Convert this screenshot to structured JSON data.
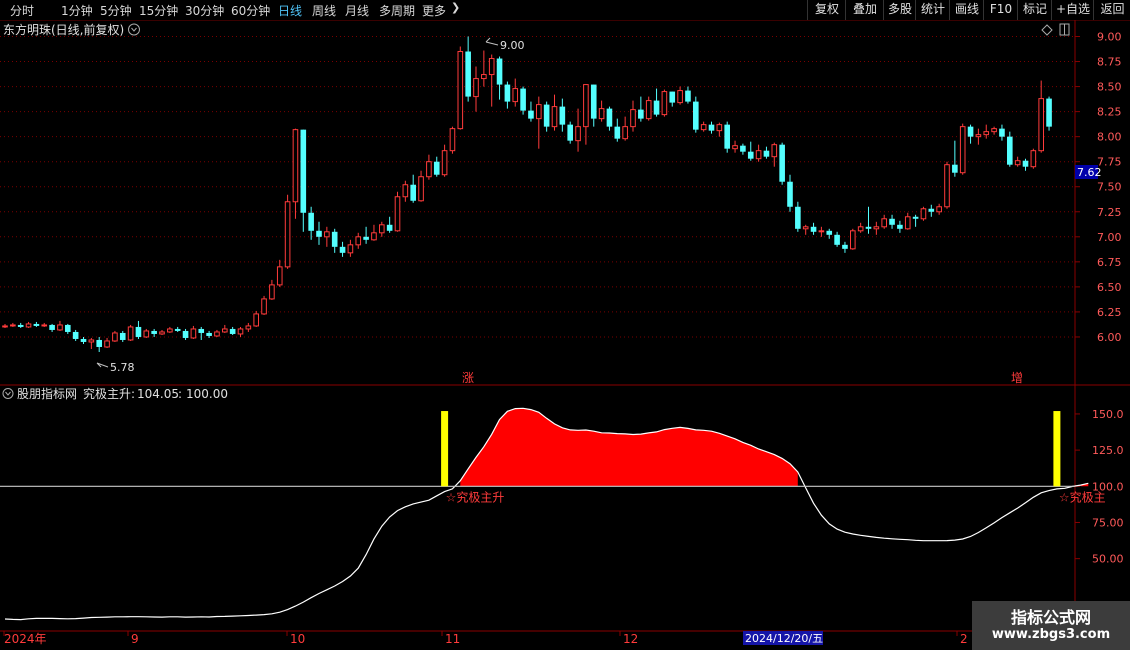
{
  "toolbar": {
    "periods": [
      "分时",
      "1分钟",
      "5分钟",
      "15分钟",
      "30分钟",
      "60分钟",
      "日线",
      "周线",
      "月线",
      "多周期",
      "更多"
    ],
    "active_period": "日线",
    "right_buttons": [
      "复权",
      "叠加",
      "多股",
      "统计",
      "画线",
      "F10",
      "标记",
      "+自选",
      "返回"
    ]
  },
  "main_chart": {
    "title": "东方明珠(日线,前复权)",
    "high_label": "9.00",
    "low_label": "5.78",
    "current_price": "7.62",
    "y_ticks": [
      "9.00",
      "8.75",
      "8.50",
      "8.25",
      "8.00",
      "7.75",
      "7.50",
      "7.25",
      "7.00",
      "6.75",
      "6.50",
      "6.25",
      "6.00"
    ],
    "markers": [
      "涨",
      "增"
    ],
    "colors": {
      "up": "#ff3b3b",
      "down": "#54ffff",
      "grid": "#7a0000"
    }
  },
  "indicator": {
    "source": "股朋指标网",
    "name": "究极主升",
    "value": "104.05",
    "ref": "100.00",
    "signal_label": "☆究极主升",
    "signal_label_cut": "☆究极主",
    "y_ticks": [
      "150.0",
      "125.0",
      "100.0",
      "75.00",
      "50.00"
    ],
    "colors": {
      "fill": "#ff0000",
      "line": "#ffffff",
      "bar": "#ffff00"
    }
  },
  "date_axis": {
    "labels": [
      "2024年",
      "9",
      "10",
      "11",
      "12",
      "2"
    ],
    "cursor_date": "2024/12/20/五"
  },
  "watermark": {
    "title": "指标公式网",
    "url": "www.zbgs3.com"
  },
  "chart_data": {
    "type": "candlestick",
    "candles": [
      [
        6.1,
        6.11,
        6.13,
        6.09
      ],
      [
        6.11,
        6.12,
        6.14,
        6.1
      ],
      [
        6.12,
        6.1,
        6.14,
        6.09
      ],
      [
        6.1,
        6.13,
        6.15,
        6.09
      ],
      [
        6.13,
        6.11,
        6.15,
        6.1
      ],
      [
        6.11,
        6.12,
        6.14,
        6.1
      ],
      [
        6.12,
        6.07,
        6.13,
        6.05
      ],
      [
        6.07,
        6.12,
        6.16,
        6.06
      ],
      [
        6.12,
        6.05,
        6.13,
        6.03
      ],
      [
        6.05,
        5.98,
        6.07,
        5.96
      ],
      [
        5.98,
        5.95,
        6.0,
        5.93
      ],
      [
        5.95,
        5.97,
        5.99,
        5.88
      ],
      [
        5.97,
        5.9,
        6.0,
        5.85
      ],
      [
        5.9,
        5.96,
        5.99,
        5.89
      ],
      [
        5.96,
        6.04,
        6.06,
        5.95
      ],
      [
        6.04,
        5.97,
        6.06,
        5.95
      ],
      [
        5.97,
        6.1,
        6.12,
        5.96
      ],
      [
        6.1,
        6.0,
        6.16,
        5.98
      ],
      [
        6.0,
        6.06,
        6.08,
        5.99
      ],
      [
        6.06,
        6.03,
        6.08,
        6.0
      ],
      [
        6.03,
        6.05,
        6.07,
        6.02
      ],
      [
        6.05,
        6.08,
        6.1,
        6.04
      ],
      [
        6.08,
        6.06,
        6.1,
        6.05
      ],
      [
        6.06,
        5.99,
        6.08,
        5.97
      ],
      [
        5.99,
        6.08,
        6.11,
        5.98
      ],
      [
        6.08,
        6.04,
        6.1,
        5.97
      ],
      [
        6.04,
        6.01,
        6.06,
        5.99
      ],
      [
        6.01,
        6.05,
        6.07,
        6.0
      ],
      [
        6.05,
        6.08,
        6.12,
        6.04
      ],
      [
        6.08,
        6.03,
        6.1,
        6.02
      ],
      [
        6.03,
        6.08,
        6.1,
        6.0
      ],
      [
        6.08,
        6.11,
        6.14,
        6.05
      ],
      [
        6.11,
        6.23,
        6.26,
        6.1
      ],
      [
        6.23,
        6.38,
        6.41,
        6.22
      ],
      [
        6.38,
        6.52,
        6.57,
        6.37
      ],
      [
        6.52,
        6.7,
        6.77,
        6.5
      ],
      [
        6.7,
        7.35,
        7.42,
        6.68
      ],
      [
        7.35,
        8.07,
        8.08,
        7.18
      ],
      [
        8.07,
        7.24,
        8.07,
        7.05
      ],
      [
        7.24,
        7.06,
        7.3,
        6.97
      ],
      [
        7.06,
        7.0,
        7.15,
        6.92
      ],
      [
        7.0,
        7.05,
        7.1,
        6.9
      ],
      [
        7.05,
        6.9,
        7.08,
        6.84
      ],
      [
        6.9,
        6.84,
        6.95,
        6.8
      ],
      [
        6.84,
        6.92,
        6.97,
        6.8
      ],
      [
        6.92,
        7.0,
        7.04,
        6.88
      ],
      [
        7.0,
        6.97,
        7.1,
        6.93
      ],
      [
        6.97,
        7.04,
        7.12,
        6.96
      ],
      [
        7.04,
        7.12,
        7.15,
        7.0
      ],
      [
        7.12,
        7.06,
        7.2,
        7.04
      ],
      [
        7.06,
        7.4,
        7.45,
        7.05
      ],
      [
        7.4,
        7.52,
        7.56,
        7.35
      ],
      [
        7.52,
        7.36,
        7.62,
        7.34
      ],
      [
        7.36,
        7.6,
        7.66,
        7.35
      ],
      [
        7.6,
        7.75,
        7.82,
        7.57
      ],
      [
        7.75,
        7.62,
        7.8,
        7.6
      ],
      [
        7.62,
        7.86,
        7.92,
        7.6
      ],
      [
        7.86,
        8.08,
        8.1,
        7.83
      ],
      [
        8.08,
        8.85,
        8.9,
        8.07
      ],
      [
        8.85,
        8.4,
        9.0,
        8.35
      ],
      [
        8.4,
        8.58,
        8.7,
        8.25
      ],
      [
        8.58,
        8.62,
        8.86,
        8.5
      ],
      [
        8.62,
        8.78,
        8.82,
        8.3
      ],
      [
        8.78,
        8.52,
        8.8,
        8.37
      ],
      [
        8.52,
        8.35,
        8.55,
        8.28
      ],
      [
        8.35,
        8.48,
        8.58,
        8.3
      ],
      [
        8.48,
        8.26,
        8.5,
        8.22
      ],
      [
        8.26,
        8.18,
        8.35,
        8.15
      ],
      [
        8.18,
        8.32,
        8.4,
        7.88
      ],
      [
        8.32,
        8.1,
        8.35,
        8.05
      ],
      [
        8.1,
        8.3,
        8.42,
        8.06
      ],
      [
        8.3,
        8.12,
        8.38,
        8.05
      ],
      [
        8.12,
        7.96,
        8.15,
        7.93
      ],
      [
        7.96,
        8.1,
        8.28,
        7.85
      ],
      [
        8.1,
        8.52,
        8.52,
        7.92
      ],
      [
        8.52,
        8.18,
        8.52,
        8.1
      ],
      [
        8.18,
        8.28,
        8.36,
        8.15
      ],
      [
        8.28,
        8.1,
        8.3,
        8.06
      ],
      [
        8.1,
        7.98,
        8.18,
        7.95
      ],
      [
        7.98,
        8.1,
        8.2,
        7.96
      ],
      [
        8.1,
        8.27,
        8.36,
        8.05
      ],
      [
        8.27,
        8.18,
        8.4,
        8.15
      ],
      [
        8.18,
        8.36,
        8.4,
        8.16
      ],
      [
        8.36,
        8.22,
        8.48,
        8.2
      ],
      [
        8.22,
        8.45,
        8.47,
        8.2
      ],
      [
        8.45,
        8.34,
        8.45,
        8.3
      ],
      [
        8.34,
        8.46,
        8.5,
        8.32
      ],
      [
        8.46,
        8.35,
        8.5,
        8.33
      ],
      [
        8.35,
        8.07,
        8.4,
        8.04
      ],
      [
        8.07,
        8.12,
        8.15,
        8.05
      ],
      [
        8.12,
        8.06,
        8.15,
        8.03
      ],
      [
        8.06,
        8.12,
        8.14,
        8.0
      ],
      [
        8.12,
        7.88,
        8.15,
        7.84
      ],
      [
        7.88,
        7.91,
        7.96,
        7.84
      ],
      [
        7.91,
        7.85,
        7.93,
        7.82
      ],
      [
        7.85,
        7.78,
        7.95,
        7.76
      ],
      [
        7.78,
        7.86,
        7.92,
        7.75
      ],
      [
        7.86,
        7.8,
        7.9,
        7.78
      ],
      [
        7.8,
        7.92,
        7.94,
        7.7
      ],
      [
        7.92,
        7.55,
        7.94,
        7.52
      ],
      [
        7.55,
        7.3,
        7.62,
        7.25
      ],
      [
        7.3,
        7.08,
        7.35,
        7.05
      ],
      [
        7.08,
        7.1,
        7.12,
        7.02
      ],
      [
        7.1,
        7.05,
        7.14,
        7.02
      ],
      [
        7.05,
        7.06,
        7.1,
        7.0
      ],
      [
        7.06,
        7.02,
        7.08,
        6.98
      ],
      [
        7.02,
        6.92,
        7.05,
        6.9
      ],
      [
        6.92,
        6.88,
        6.95,
        6.84
      ],
      [
        6.88,
        7.06,
        7.08,
        6.87
      ],
      [
        7.06,
        7.1,
        7.14,
        7.04
      ],
      [
        7.1,
        7.08,
        7.3,
        7.03
      ],
      [
        7.08,
        7.1,
        7.15,
        7.02
      ],
      [
        7.1,
        7.18,
        7.22,
        7.08
      ],
      [
        7.18,
        7.12,
        7.22,
        7.08
      ],
      [
        7.12,
        7.08,
        7.16,
        7.04
      ],
      [
        7.08,
        7.2,
        7.24,
        7.07
      ],
      [
        7.2,
        7.18,
        7.22,
        7.1
      ],
      [
        7.18,
        7.28,
        7.3,
        7.16
      ],
      [
        7.28,
        7.25,
        7.32,
        7.2
      ],
      [
        7.25,
        7.3,
        7.33,
        7.22
      ],
      [
        7.3,
        7.72,
        7.75,
        7.28
      ],
      [
        7.72,
        7.64,
        7.96,
        7.6
      ],
      [
        7.64,
        8.1,
        8.13,
        7.62
      ],
      [
        8.1,
        8.0,
        8.12,
        7.93
      ],
      [
        8.0,
        8.02,
        8.08,
        7.92
      ],
      [
        8.02,
        8.05,
        8.12,
        7.98
      ],
      [
        8.05,
        8.08,
        8.1,
        8.02
      ],
      [
        8.08,
        8.0,
        8.12,
        7.96
      ],
      [
        8.0,
        7.72,
        8.05,
        7.7
      ],
      [
        7.72,
        7.76,
        7.8,
        7.7
      ],
      [
        7.76,
        7.7,
        7.78,
        7.66
      ],
      [
        7.7,
        7.86,
        7.88,
        7.68
      ],
      [
        7.86,
        8.38,
        8.56,
        7.84
      ],
      [
        8.38,
        8.1,
        8.4,
        8.06
      ]
    ],
    "oscillator": [
      0.83,
      0.8,
      0.79,
      0.84,
      0.87,
      0.88,
      0.87,
      0.86,
      0.84,
      0.86,
      0.89,
      0.93,
      0.95,
      0.96,
      0.98,
      0.98,
      0.99,
      0.99,
      0.98,
      0.97,
      0.96,
      0.98,
      0.98,
      0.96,
      0.97,
      0.98,
      0.97,
      1.0,
      1.01,
      1.03,
      1.05,
      1.07,
      1.1,
      1.13,
      1.19,
      1.3,
      1.48,
      1.72,
      2.0,
      2.3,
      2.59,
      2.85,
      3.11,
      3.42,
      3.8,
      4.35,
      5.28,
      6.35,
      7.24,
      7.88,
      8.32,
      8.58,
      8.78,
      8.91,
      9.04,
      9.34,
      9.63,
      9.82,
      10.39,
      11.2,
      12.0,
      12.73,
      13.59,
      14.61,
      15.18,
      15.37,
      15.39,
      15.3,
      15.11,
      14.7,
      14.31,
      14.04,
      13.9,
      13.87,
      13.89,
      13.81,
      13.7,
      13.68,
      13.64,
      13.62,
      13.58,
      13.61,
      13.69,
      13.76,
      13.92,
      14.01,
      14.07,
      14.0,
      13.9,
      13.87,
      13.81,
      13.66,
      13.47,
      13.28,
      13.03,
      12.83,
      12.58,
      12.39,
      12.19,
      11.93,
      11.56,
      10.99,
      9.89,
      8.83,
      8.0,
      7.4,
      7.04,
      6.83,
      6.7,
      6.61,
      6.54,
      6.47,
      6.41,
      6.37,
      6.34,
      6.31,
      6.27,
      6.24,
      6.24,
      6.24,
      6.25,
      6.28,
      6.36,
      6.53,
      6.81,
      7.13,
      7.47,
      7.84,
      8.17,
      8.49,
      8.86,
      9.24,
      9.55,
      9.7,
      9.82,
      9.86,
      9.99,
      10.08,
      10.21
    ],
    "main_ylim": [
      5.78,
      9.0
    ],
    "indicator_ylim": [
      0,
      170
    ],
    "signal_days": [
      56,
      134
    ]
  }
}
